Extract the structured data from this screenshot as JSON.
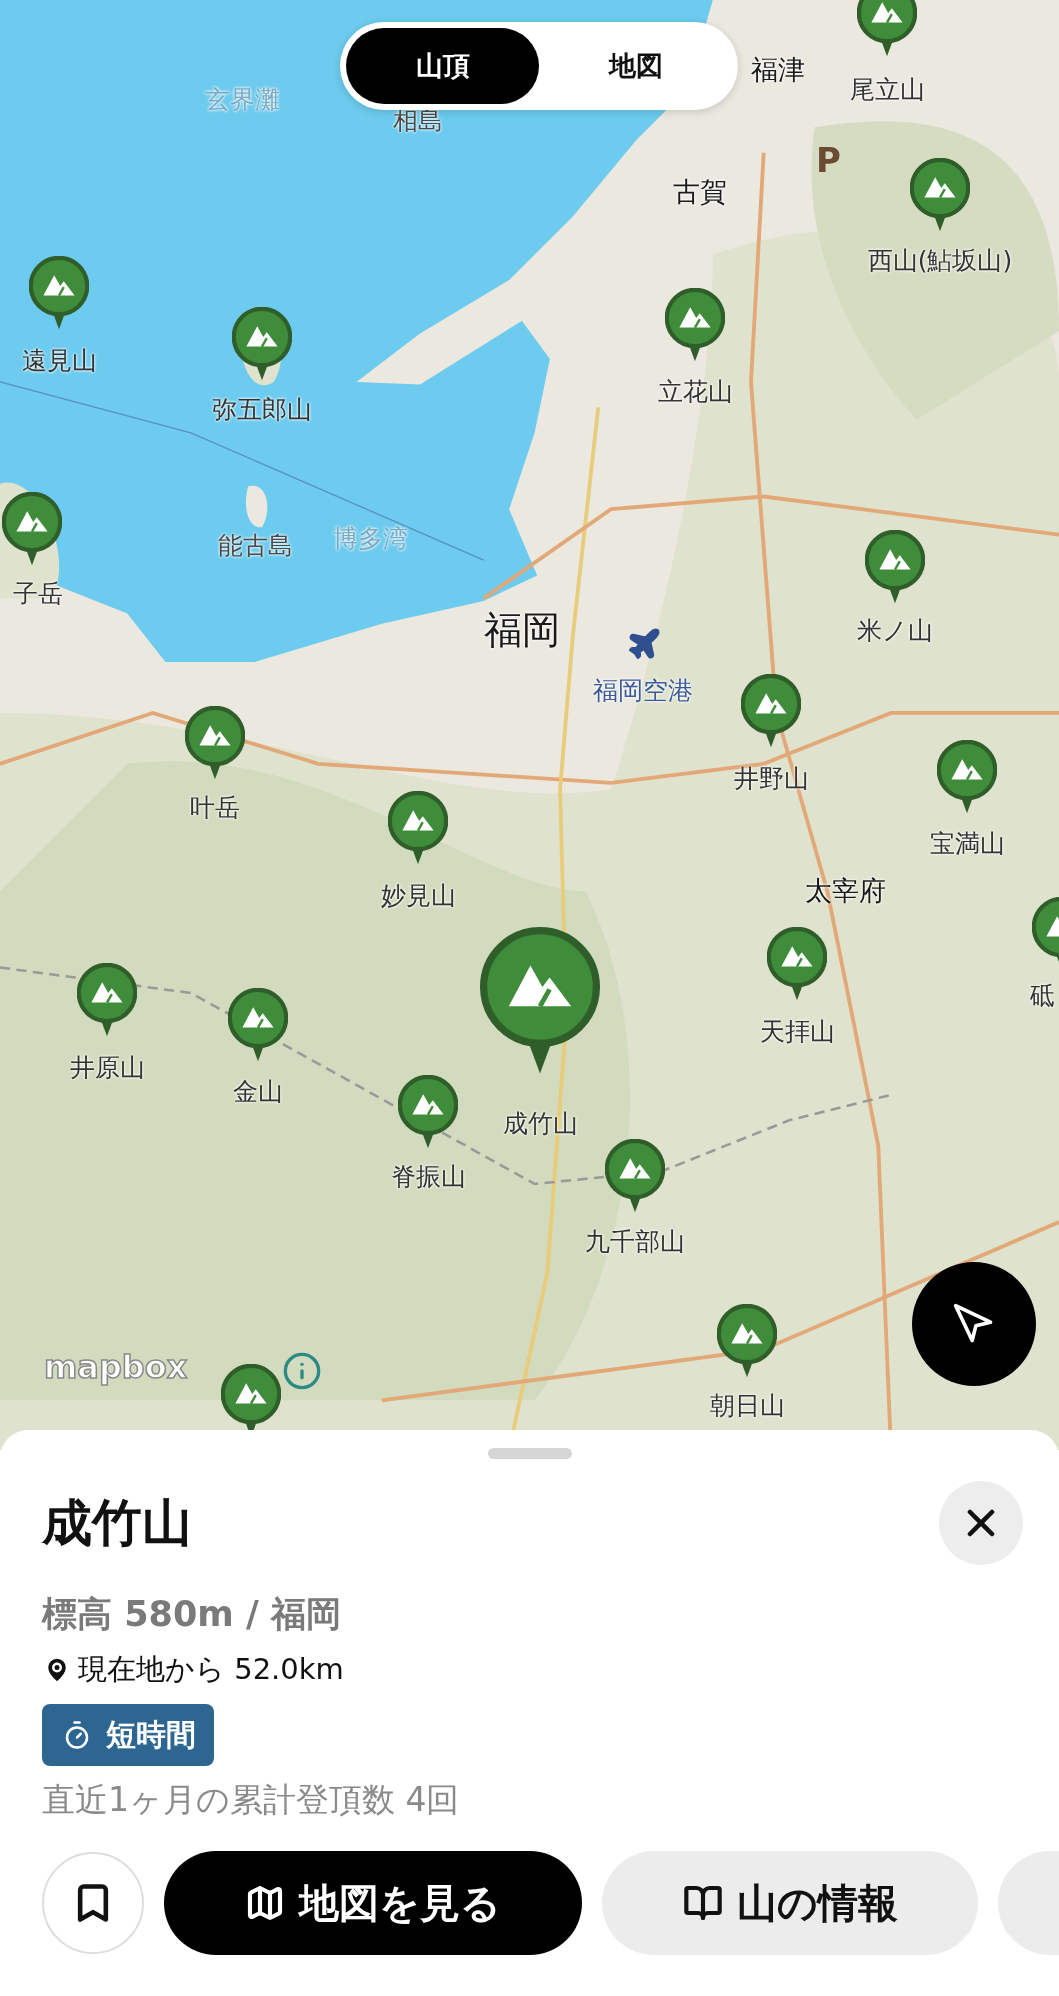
{
  "toggle": [
    {
      "label": "山頂",
      "selected": true
    },
    {
      "label": "地図",
      "selected": false
    }
  ],
  "places": [
    {
      "label": "玄界灘",
      "kind": "sea"
    },
    {
      "label": "相島",
      "kind": "island"
    },
    {
      "label": "福津",
      "kind": "town"
    },
    {
      "label": "古賀",
      "kind": "town"
    },
    {
      "label": "能古島",
      "kind": "island"
    },
    {
      "label": "博多湾",
      "kind": "sea"
    },
    {
      "label": "福岡",
      "kind": "city"
    },
    {
      "label": "福岡空港",
      "kind": "airport"
    },
    {
      "label": "太宰府",
      "kind": "town"
    }
  ],
  "peaks": [
    {
      "name": "尾立山",
      "selected": false
    },
    {
      "name": "西山(鮎坂山)",
      "selected": false
    },
    {
      "name": "遠見山",
      "selected": false
    },
    {
      "name": "弥五郎山",
      "selected": false
    },
    {
      "name": "立花山",
      "selected": false
    },
    {
      "name": "子岳",
      "selected": false
    },
    {
      "name": "米ノ山",
      "selected": false
    },
    {
      "name": "井野山",
      "selected": false
    },
    {
      "name": "宝満山",
      "selected": false
    },
    {
      "name": "叶岳",
      "selected": false
    },
    {
      "name": "妙見山",
      "selected": false
    },
    {
      "name": "成竹山",
      "selected": true
    },
    {
      "name": "天拝山",
      "selected": false
    },
    {
      "name": "井原山",
      "selected": false
    },
    {
      "name": "金山",
      "selected": false
    },
    {
      "name": "脊振山",
      "selected": false
    },
    {
      "name": "九千部山",
      "selected": false
    },
    {
      "name": "朝日山",
      "selected": false
    },
    {
      "name": "砥",
      "selected": false
    },
    {
      "selected": false
    }
  ],
  "attribution": "mapbox",
  "parking_sign": "P",
  "sheet": {
    "title": "成竹山",
    "elevation": "標高 580m / 福岡",
    "distance": "現在地から 52.0km",
    "tag": "短時間",
    "summit_count": "直近1ヶ月の累計登頂数 4回",
    "buttons": [
      {
        "label": "地図を見る",
        "kind": "primary"
      },
      {
        "label": "山の情報",
        "kind": "secondary"
      },
      {
        "kind": "secondary"
      }
    ]
  }
}
